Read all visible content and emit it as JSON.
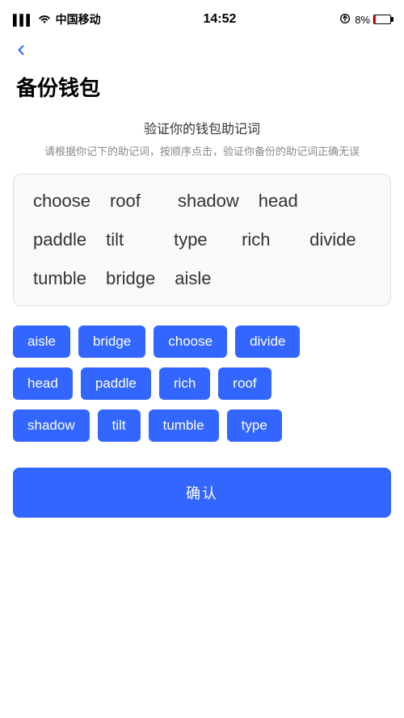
{
  "statusBar": {
    "carrier": "中国移动",
    "time": "14:52",
    "batteryPercent": "8%"
  },
  "back": {
    "label": "‹"
  },
  "page": {
    "title": "备份钱包"
  },
  "verifySection": {
    "heading": "验证你的钱包助记词",
    "desc": "请根据你记下的助记词，按顺序点击，验证你备份的助记词正确无误"
  },
  "displayWords": {
    "row1": [
      "choose",
      "roof",
      "shadow",
      "head"
    ],
    "row2": [
      "paddle",
      "tilt",
      "type",
      "rich",
      "divide"
    ],
    "row3": [
      "tumble",
      "bridge",
      "aisle"
    ]
  },
  "chips": {
    "row1": [
      "aisle",
      "bridge",
      "choose",
      "divide"
    ],
    "row2": [
      "head",
      "paddle",
      "rich",
      "roof"
    ],
    "row3": [
      "shadow",
      "tilt",
      "tumble",
      "type"
    ]
  },
  "confirmButton": {
    "label": "确认"
  }
}
